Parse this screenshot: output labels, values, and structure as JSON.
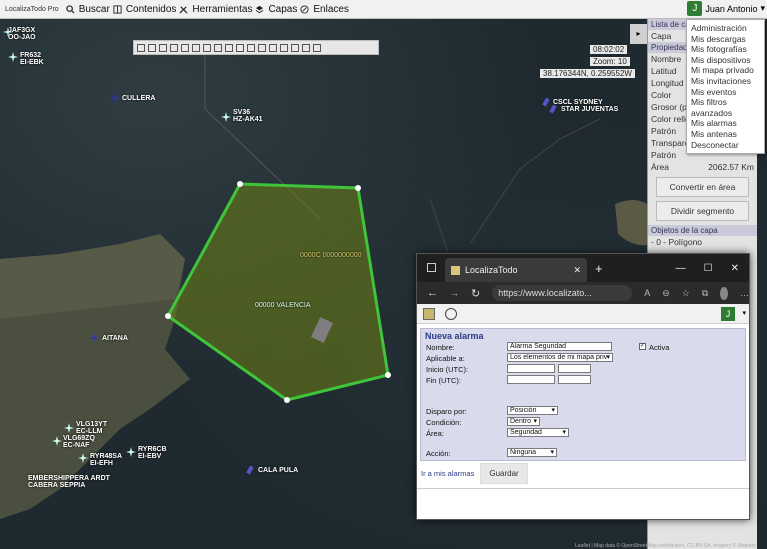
{
  "app": {
    "logo_text": "LocalizaTodo Pro",
    "menu": [
      {
        "label": "Buscar",
        "icon": "search-icon"
      },
      {
        "label": "Contenidos",
        "icon": "book-icon"
      },
      {
        "label": "Herramientas",
        "icon": "tools-icon"
      },
      {
        "label": "Capas",
        "icon": "layers-icon"
      },
      {
        "label": "Enlaces",
        "icon": "link-icon"
      }
    ],
    "user": {
      "initial": "J",
      "name": "Juan Antonio"
    }
  },
  "user_menu": [
    "Administración",
    "Mis descargas",
    "Mis fotografías",
    "Mis dispositivos",
    "Mi mapa privado",
    "Mis invitaciones",
    "Mis eventos",
    "Mis filtros avanzados",
    "Mis alarmas",
    "Mis antenas",
    "Desconectar"
  ],
  "map": {
    "time": "08:02:02",
    "zoom": "Zoom: 10",
    "coords": "38.176344N, 0.259552W",
    "aircraft": [
      {
        "lines": [
          "JAF3GX",
          "OO-JAO"
        ]
      },
      {
        "lines": [
          "FR632",
          "EI-EBK"
        ]
      },
      {
        "lines": [
          "SV36",
          "HZ-AK41"
        ]
      },
      {
        "lines": [
          "VLG13YT",
          "EC-LLM"
        ]
      },
      {
        "lines": [
          "VLG69ZQ",
          "EC-NAF"
        ]
      },
      {
        "lines": [
          "RYR48SA",
          "EI-EFH"
        ]
      },
      {
        "lines": [
          "RYR6CB",
          "EI-EBV"
        ]
      }
    ],
    "places": [
      "CULLERA",
      "AITANA",
      "CALA PULA",
      "CSCL SYDNEY",
      "STAR JUVENTAS",
      "EMBERSHIPPERA ARDT",
      "CABERA SEPPIA"
    ],
    "polygon_labels": [
      "0000C 0000000000",
      "00000 VALENCIA"
    ]
  },
  "side_panel": {
    "header": "Lista de capas",
    "fields": [
      "Capa",
      "Propiedades",
      "Nombre",
      "Latitud",
      "Longitud",
      "Color",
      "Grosor (px)",
      "Color relleno",
      "Patrón",
      "Transparencia",
      "Patrón",
      "Área"
    ],
    "area_value": "2062.57 Km",
    "btn_convert": "Convertir en área",
    "btn_divide": "Dividir segmento",
    "objects_header": "Objetos de la capa",
    "objects_item": "- 0 - Polígono"
  },
  "browser": {
    "tab_title": "LocalizaTodo",
    "url": "https://www.localizato...",
    "app_user_initial": "J"
  },
  "form": {
    "title": "Nueva alarma",
    "name_label": "Nombre:",
    "name_value": "Alarma Seguridad",
    "active_label": "Activa",
    "apply_label": "Aplicable a:",
    "apply_value": "Los elementos de mi mapa priv",
    "start_label": "Inicio (UTC):",
    "end_label": "Fin (UTC):",
    "trigger_label": "Disparo por:",
    "trigger_value": "Posición",
    "condition_label": "Condición:",
    "condition_value": "Dentro",
    "area_label": "Área:",
    "area_value": "Seguridad",
    "action_label": "Acción:",
    "action_value": "Ninguna",
    "link_my_alarms": "Ir a mis alarmas",
    "save_label": "Guardar"
  },
  "attribution": "Leaflet | Map data © OpenStreetMap contributors, CC-BY-SA, Imagery © Mapbox"
}
